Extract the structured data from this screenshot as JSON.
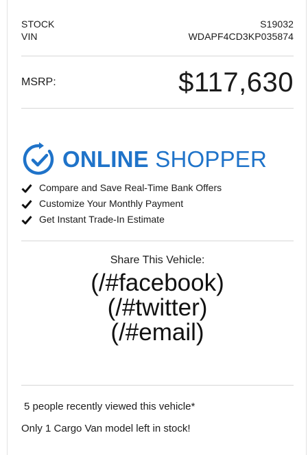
{
  "vehicle": {
    "stock_label": "STOCK",
    "stock_value": "S19032",
    "vin_label": "VIN",
    "vin_value": "WDAPF4CD3KP035874",
    "msrp_label": "MSRP:",
    "msrp_value": "$117,630"
  },
  "online_shopper": {
    "logo_word_bold": "ONLINE",
    "logo_word_light": "SHOPPER",
    "logo_color": "#1f73c9",
    "features": [
      "Compare and Save Real-Time Bank Offers",
      "Customize Your Monthly Payment",
      "Get Instant Trade-In Estimate"
    ],
    "feature_icon": "check-icon"
  },
  "share": {
    "title": "Share This Vehicle:",
    "facebook": "(/#facebook)",
    "twitter": "(/#twitter)",
    "email": "(/#email)"
  },
  "notes": {
    "recent_views": "5 people recently viewed this vehicle*",
    "stock_left": "Only 1 Cargo Van model left in stock!"
  }
}
